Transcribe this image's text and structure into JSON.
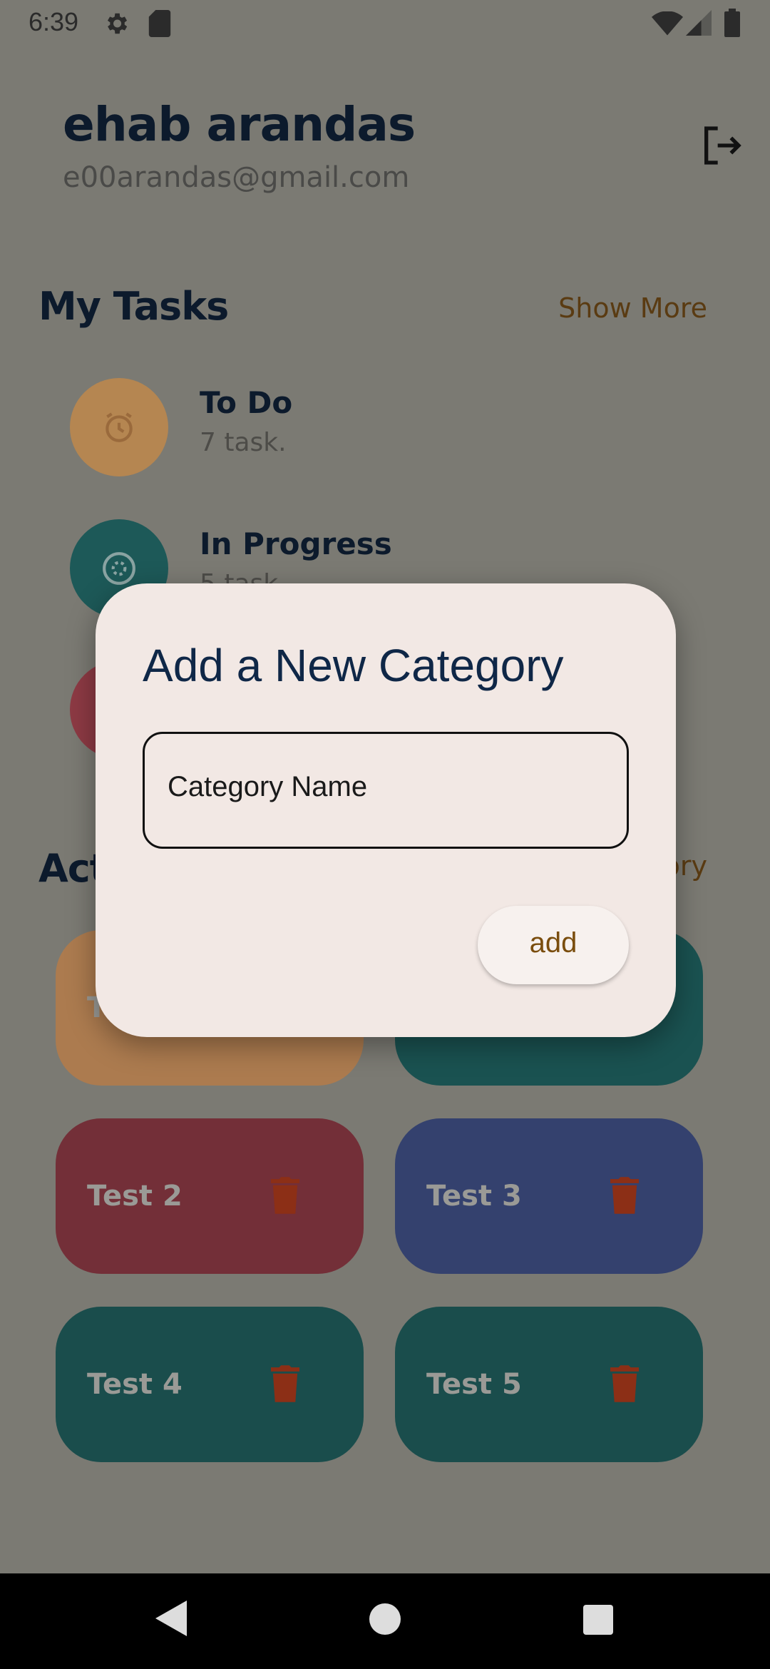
{
  "status_bar": {
    "time": "6:39",
    "icons": [
      "settings-icon",
      "sd-card-icon",
      "wifi-icon",
      "signal-icon",
      "battery-icon"
    ]
  },
  "header": {
    "user_name": "ehab arandas",
    "email": "e00arandas@gmail.com",
    "logout_icon": "logout-icon"
  },
  "my_tasks": {
    "title": "My Tasks",
    "link": "Show More",
    "items": [
      {
        "title": "To Do",
        "count": "7 task.",
        "icon": "alarm-icon",
        "color": "#b58651"
      },
      {
        "title": "In Progress",
        "count": "5 task.",
        "icon": "progress-icon",
        "color": "#1d5958"
      },
      {
        "title": "",
        "count": "",
        "icon": "",
        "color": "#8d3a44"
      }
    ]
  },
  "categories": {
    "title_fragment": "Act",
    "link_fragment": "ory",
    "cards": [
      {
        "label": "T",
        "color": "#ac7b4f"
      },
      {
        "label": "",
        "color": "#1a5251"
      },
      {
        "label": "Test 2",
        "color": "#732f38"
      },
      {
        "label": "Test 3",
        "color": "#34416e"
      },
      {
        "label": "Test 4",
        "color": "#1a4d4c"
      },
      {
        "label": "Test 5",
        "color": "#1a4d4c"
      }
    ],
    "trash_color": "#8c2f16"
  },
  "dialog": {
    "title": "Add a New Category",
    "input_label": "Category Name",
    "add_label": "add"
  },
  "nav": {
    "back_icon": "back-icon",
    "home_icon": "home-icon",
    "recents_icon": "recents-icon"
  }
}
